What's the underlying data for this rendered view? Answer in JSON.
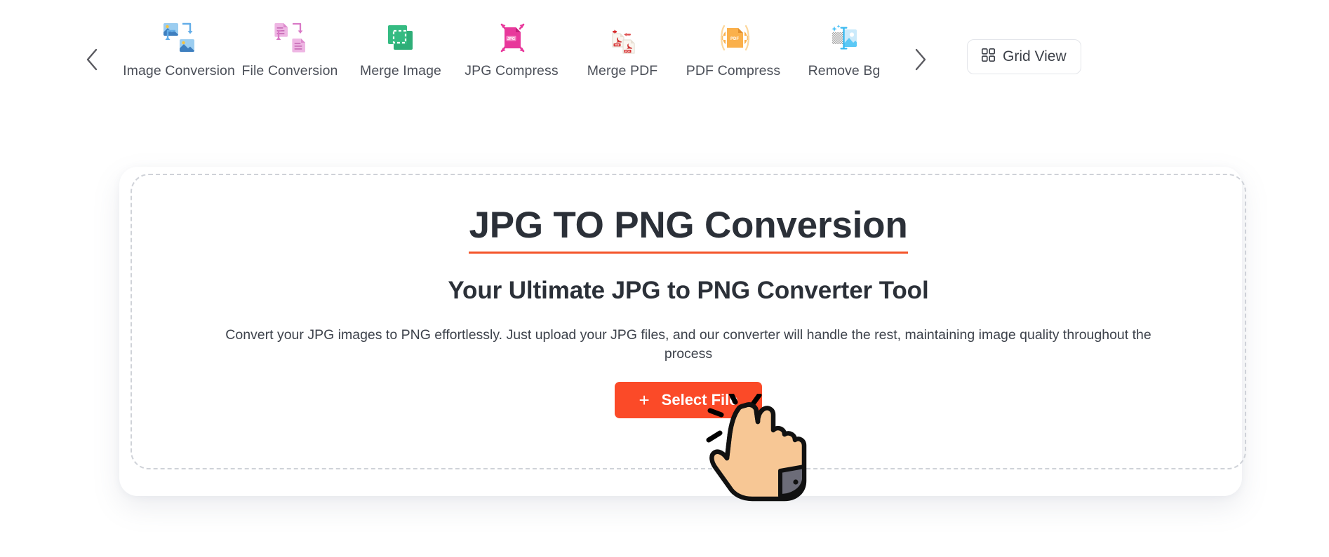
{
  "toolbar": {
    "prev_label": "chevron-left",
    "next_label": "chevron-right",
    "grid_view_label": "Grid View",
    "tools": [
      {
        "label": "Image Conversion",
        "icon": "image-conversion-icon",
        "color": "#5BA3E0"
      },
      {
        "label": "File Conversion",
        "icon": "file-conversion-icon",
        "color": "#E17FCB"
      },
      {
        "label": "Merge Image",
        "icon": "merge-image-icon",
        "color": "#2FB07A"
      },
      {
        "label": "JPG Compress",
        "icon": "jpg-compress-icon",
        "color": "#E8389B"
      },
      {
        "label": "Merge PDF",
        "icon": "merge-pdf-icon",
        "color": "#D62B2B"
      },
      {
        "label": "PDF Compress",
        "icon": "pdf-compress-icon",
        "color": "#FAB04B"
      },
      {
        "label": "Remove Bg",
        "icon": "remove-bg-icon",
        "color": "#5BC8F5"
      }
    ]
  },
  "main": {
    "title": "JPG TO PNG Conversion",
    "subtitle": "Your Ultimate JPG to PNG Converter Tool",
    "description": "Convert your JPG images to PNG effortlessly. Just upload your JPG files, and our converter will handle the rest, maintaining image quality throughout the process",
    "select_file_label": "Select File",
    "select_file_plus": "+",
    "accent_color": "#FB4A28",
    "underline_color": "#F4552A"
  },
  "cursor": {
    "icon": "pointing-hand-cursor",
    "skin_color": "#F7C795",
    "cuff_color": "#6C6C78"
  }
}
